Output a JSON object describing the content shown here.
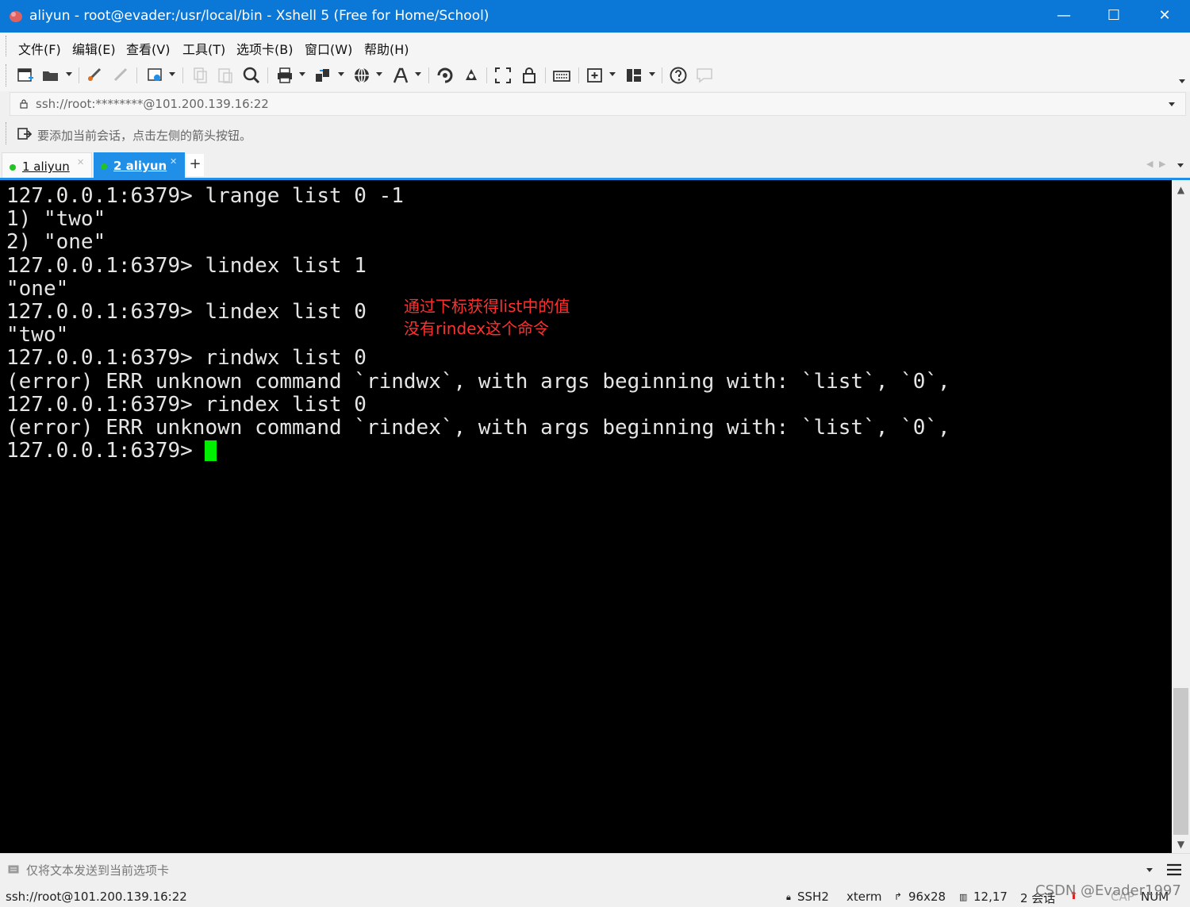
{
  "window": {
    "title": "aliyun - root@evader:/usr/local/bin - Xshell 5 (Free for Home/School)",
    "controls": {
      "minimize": "—",
      "maximize": "☐",
      "close": "✕"
    },
    "accent_color": "#0b78d7"
  },
  "menu": [
    "文件(F)",
    "编辑(E)",
    "查看(V)",
    "工具(T)",
    "选项卡(B)",
    "窗口(W)",
    "帮助(H)"
  ],
  "toolbar": {
    "icons": [
      "new-session-icon",
      "open-folder-icon",
      "reconnect-icon",
      "disconnect-icon",
      "properties-icon",
      "copy-icon",
      "paste-icon",
      "find-icon",
      "print-icon",
      "transfer-icon",
      "globe-icon",
      "font-icon",
      "xftp-icon",
      "xmanager-icon",
      "fullscreen-icon",
      "lock-icon",
      "keyboard-icon",
      "add-tab-icon",
      "layout-icon",
      "help-icon",
      "chat-icon"
    ]
  },
  "address": {
    "value": "ssh://root:********@101.200.139.16:22"
  },
  "info": {
    "text": "要添加当前会话，点击左侧的箭头按钮。"
  },
  "tabs": [
    {
      "label": "1 aliyun",
      "active": false
    },
    {
      "label": "2 aliyun",
      "active": true
    }
  ],
  "tab_add_label": "+",
  "tab_nav": {
    "prev": "◀",
    "next": "▶"
  },
  "terminal": {
    "lines": [
      "127.0.0.1:6379> lrange list 0 -1",
      "1) \"two\"",
      "2) \"one\"",
      "127.0.0.1:6379> lindex list 1",
      "\"one\"",
      "127.0.0.1:6379> lindex list 0",
      "\"two\"",
      "127.0.0.1:6379> rindwx list 0",
      "(error) ERR unknown command `rindwx`, with args beginning with: `list`, `0`,",
      "127.0.0.1:6379> rindex list 0",
      "(error) ERR unknown command `rindex`, with args beginning with: `list`, `0`,"
    ],
    "prompt": "127.0.0.1:6379> ",
    "cursor_color": "#00ee00",
    "annotation": [
      "通过下标获得list中的值",
      "没有rindex这个命令"
    ],
    "annotation_color": "#ff3030"
  },
  "scroll": {
    "up": "▲",
    "down": "▼"
  },
  "compose": {
    "placeholder": "仅将文本发送到当前选项卡"
  },
  "status": {
    "connection": "ssh://root@101.200.139.16:22",
    "protocol": "SSH2",
    "terminal_type": "xterm",
    "size": "96x28",
    "cursor_pos": "12,17",
    "sessions": "2 会话",
    "caps": "CAP",
    "num": "NUM"
  },
  "watermark": "CSDN @Evader1997"
}
